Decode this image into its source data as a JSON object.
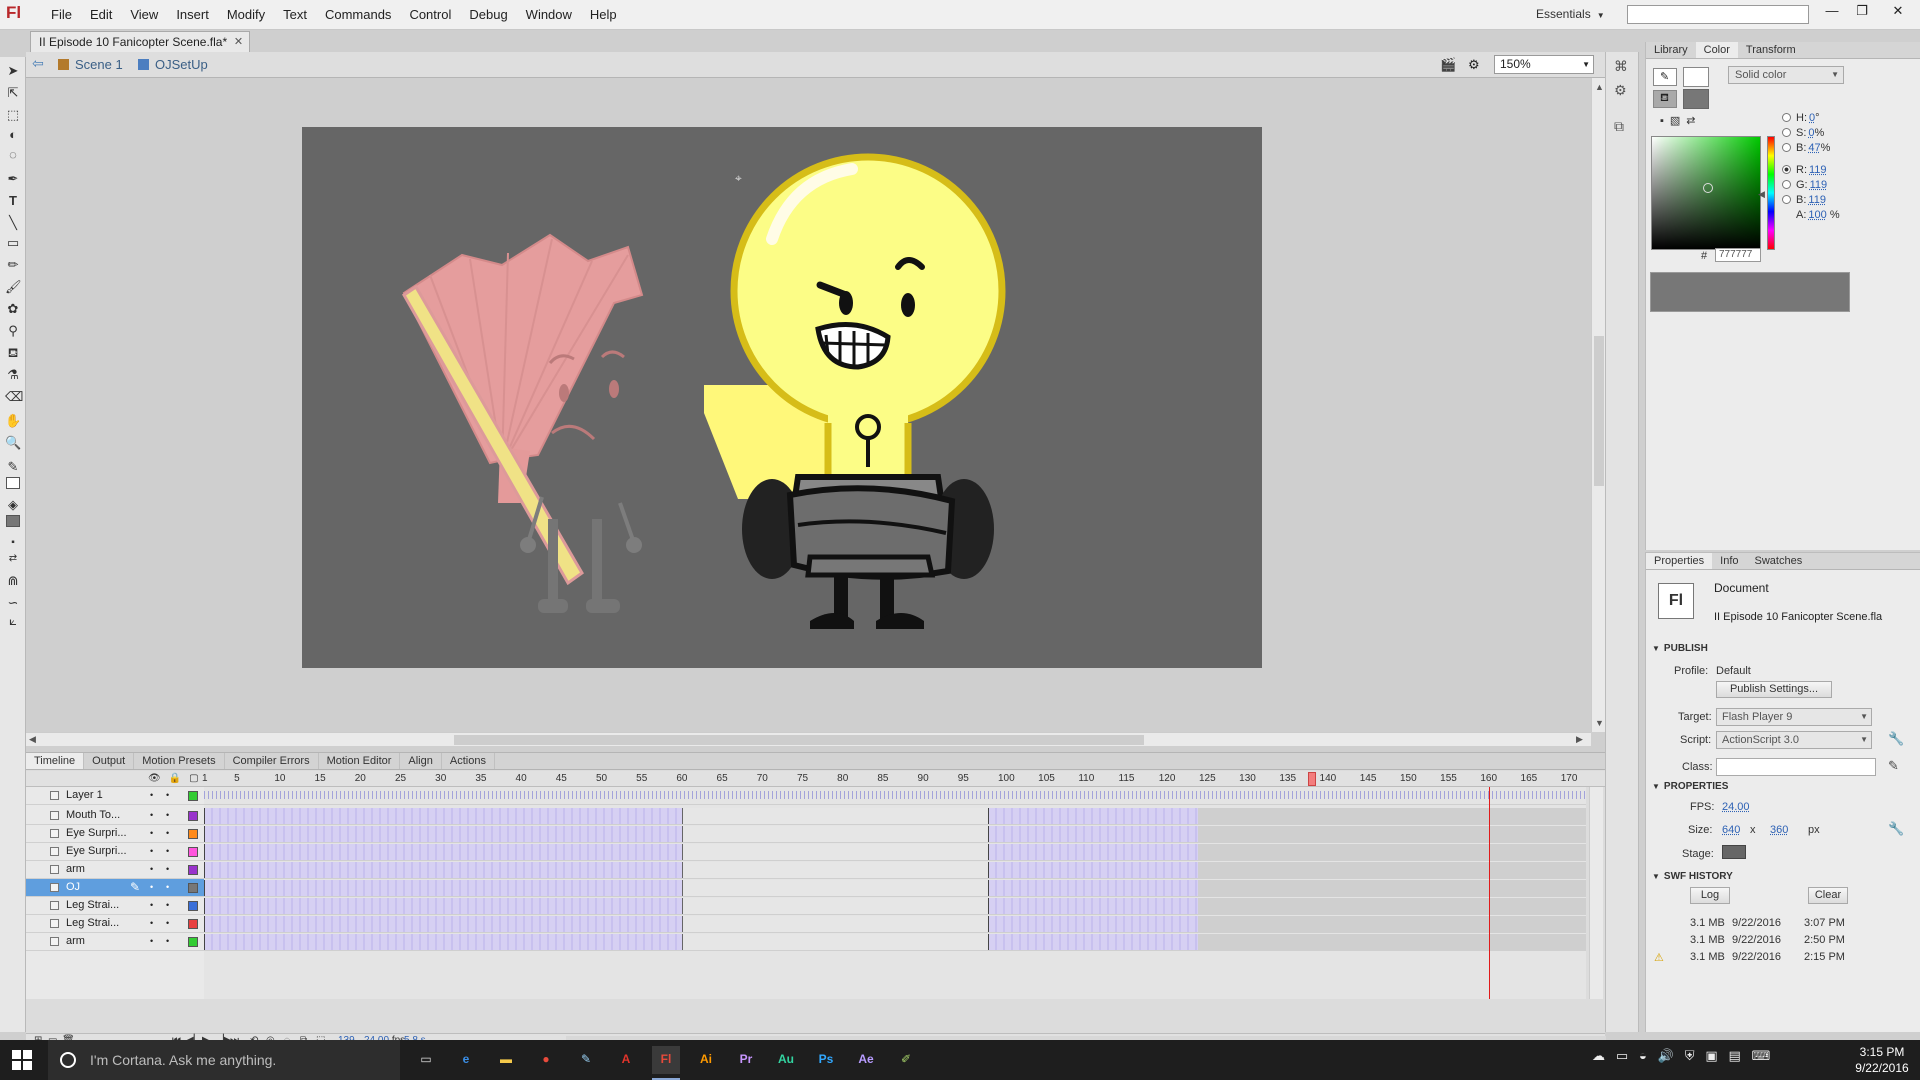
{
  "app": {
    "logo": "Fl",
    "menu": [
      "File",
      "Edit",
      "View",
      "Insert",
      "Modify",
      "Text",
      "Commands",
      "Control",
      "Debug",
      "Window",
      "Help"
    ],
    "workspace": "Essentials",
    "search_value": ""
  },
  "document": {
    "tab_title": "II Episode 10 Fanicopter Scene.fla*",
    "breadcrumb_scene": "Scene 1",
    "breadcrumb_symbol": "OJSetUp",
    "zoom": "150%",
    "stage_color": "#666666"
  },
  "color_panel": {
    "tabs": [
      "Library",
      "Color",
      "Transform"
    ],
    "active_tab": "Color",
    "fill_type": "Solid color",
    "hsb": {
      "h": "0",
      "h_unit": "°",
      "s": "0",
      "s_unit": "%",
      "b": "47",
      "b_unit": "%"
    },
    "rgb": {
      "r": "119",
      "g": "119",
      "b": "119"
    },
    "alpha": "100",
    "alpha_unit": "%",
    "hex": "777777",
    "labels": {
      "h": "H:",
      "s": "S:",
      "b": "B:",
      "r": "R:",
      "g": "G:",
      "b2": "B:",
      "a": "A:",
      "hash": "#"
    },
    "fill_color": "#777777"
  },
  "properties": {
    "tabs": [
      "Properties",
      "Info",
      "Swatches"
    ],
    "doc_icon": "Fl",
    "doc_type": "Document",
    "doc_name": "II Episode 10 Fanicopter Scene.fla",
    "publish_header": "PUBLISH",
    "profile_label": "Profile:",
    "profile_value": "Default",
    "publish_settings_button": "Publish Settings...",
    "target_label": "Target:",
    "target_value": "Flash Player 9",
    "script_label": "Script:",
    "script_value": "ActionScript 3.0",
    "class_label": "Class:",
    "properties_header": "PROPERTIES",
    "fps_label": "FPS:",
    "fps_value": "24.00",
    "size_label": "Size:",
    "size_w": "640",
    "size_x": "x",
    "size_h": "360",
    "size_unit": "px",
    "stage_label": "Stage:",
    "swf_history_header": "SWF HISTORY",
    "log_button": "Log",
    "clear_button": "Clear",
    "history": [
      {
        "size": "3.1 MB",
        "date": "9/22/2016",
        "time": "3:07 PM",
        "warning": false
      },
      {
        "size": "3.1 MB",
        "date": "9/22/2016",
        "time": "2:50 PM",
        "warning": false
      },
      {
        "size": "3.1 MB",
        "date": "9/22/2016",
        "time": "2:15 PM",
        "warning": true
      }
    ]
  },
  "timeline": {
    "tabs": [
      "Timeline",
      "Output",
      "Motion Presets",
      "Compiler Errors",
      "Motion Editor",
      "Align",
      "Actions"
    ],
    "active_tab": "Timeline",
    "ruler": [
      "1",
      "5",
      "10",
      "15",
      "20",
      "25",
      "30",
      "35",
      "40",
      "45",
      "50",
      "55",
      "60",
      "65",
      "70",
      "75",
      "80",
      "85",
      "90",
      "95",
      "100",
      "105",
      "110",
      "115",
      "120",
      "125",
      "130",
      "135",
      "140",
      "145",
      "150",
      "155",
      "160",
      "165",
      "170"
    ],
    "current_frame": "139",
    "fps": "24.00",
    "fps_unit": "fps",
    "elapsed": "5.8 s",
    "layers": [
      {
        "name": "Layer 1",
        "color": "#33cc33",
        "selected": false
      },
      {
        "name": "Mouth To...",
        "color": "#9933cc",
        "selected": false
      },
      {
        "name": "Eye Surpri...",
        "color": "#ff8a1a",
        "selected": false
      },
      {
        "name": "Eye Surpri...",
        "color": "#ff55dd",
        "selected": false
      },
      {
        "name": "arm",
        "color": "#9933cc",
        "selected": false
      },
      {
        "name": "OJ",
        "color": "#777777",
        "selected": true
      },
      {
        "name": "Leg Strai...",
        "color": "#3a6fd8",
        "selected": false
      },
      {
        "name": "Leg Strai...",
        "color": "#e84040",
        "selected": false
      },
      {
        "name": "arm",
        "color": "#33cc33",
        "selected": false
      }
    ]
  },
  "taskbar": {
    "cortana_placeholder": "I'm Cortana. Ask me anything.",
    "apps": [
      {
        "name": "task-view",
        "label": "▭"
      },
      {
        "name": "edge",
        "label": "e"
      },
      {
        "name": "file-explorer",
        "label": "▬"
      },
      {
        "name": "chrome",
        "label": "●"
      },
      {
        "name": "paint",
        "label": "✎"
      },
      {
        "name": "acrobat",
        "label": "A"
      },
      {
        "name": "animate",
        "label": "Fl"
      },
      {
        "name": "illustrator",
        "label": "Ai"
      },
      {
        "name": "premiere",
        "label": "Pr"
      },
      {
        "name": "audition",
        "label": "Au"
      },
      {
        "name": "photoshop",
        "label": "Ps"
      },
      {
        "name": "after-effects",
        "label": "Ae"
      },
      {
        "name": "notepad",
        "label": "✐"
      }
    ],
    "time": "3:15 PM",
    "date": "9/22/2016"
  }
}
